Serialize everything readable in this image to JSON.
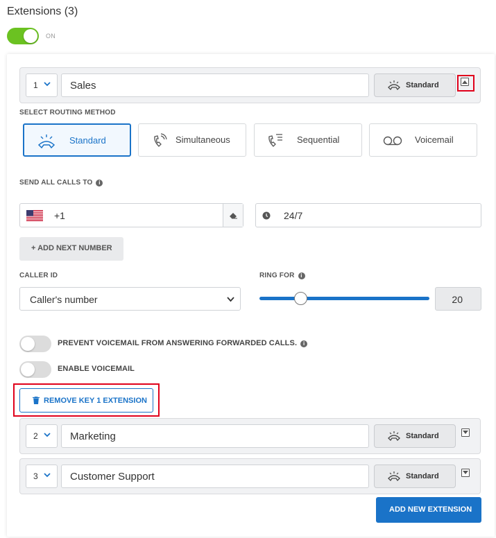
{
  "header": {
    "title": "Extensions (3)",
    "master_toggle_state": "on",
    "master_toggle_label": "ON"
  },
  "extensions": [
    {
      "key": "1",
      "name": "Sales",
      "routing_label": "Standard",
      "expanded": true
    },
    {
      "key": "2",
      "name": "Marketing",
      "routing_label": "Standard",
      "expanded": false
    },
    {
      "key": "3",
      "name": "Customer Support",
      "routing_label": "Standard",
      "expanded": false
    }
  ],
  "details": {
    "routing_section_label": "SELECT ROUTING METHOD",
    "routing_methods": [
      "Standard",
      "Simultaneous",
      "Sequential",
      "Voicemail"
    ],
    "active_routing_method": "Standard",
    "send_calls_label": "SEND ALL CALLS TO",
    "phone_country_code": "+1",
    "schedule_value": "24/7",
    "add_next_label": "+ ADD NEXT NUMBER",
    "caller_id_label": "CALLER ID",
    "caller_id_value": "Caller's number",
    "ring_for_label": "RING FOR",
    "ring_for_value": "20",
    "ring_for_slider_fraction": 0.24,
    "prevent_voicemail_label": "PREVENT VOICEMAIL FROM ANSWERING FORWARDED CALLS.",
    "prevent_voicemail_state": "off",
    "enable_voicemail_label": "ENABLE VOICEMAIL",
    "enable_voicemail_state": "off",
    "remove_label": "REMOVE KEY 1 EXTENSION"
  },
  "footer": {
    "add_extension_label": "ADD NEW EXTENSION"
  },
  "colors": {
    "accent": "#1a73c8",
    "toggle_on": "#6bc221",
    "highlight": "#e0001b"
  },
  "icons": {
    "routing": [
      "phone-standard-icon",
      "phone-ring-icon",
      "phone-list-icon",
      "voicemail-icon"
    ],
    "misc": [
      "chevron-down-icon",
      "collapse-icon",
      "expand-icon",
      "us-flag-icon",
      "eraser-icon",
      "clock-icon",
      "info-icon",
      "trash-icon"
    ]
  }
}
